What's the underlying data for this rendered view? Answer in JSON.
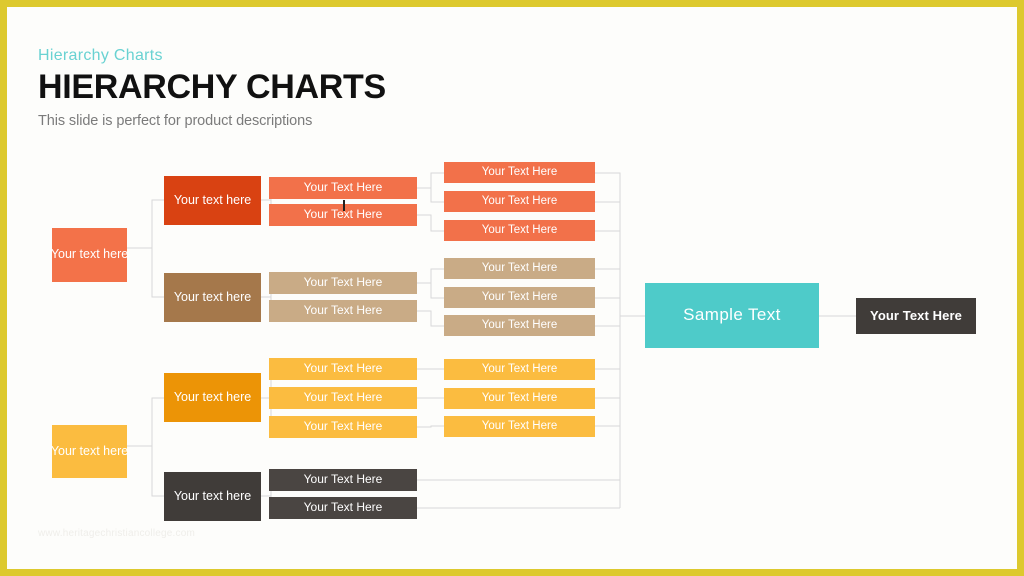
{
  "slide": {
    "eyebrow": "Hierarchy Charts",
    "title": "HIERARCHY CHARTS",
    "subtitle": "This slide is perfect for product descriptions",
    "watermark": "www.heritagechristiancollege.com",
    "frame_color": "#ddc92e",
    "background": "#fdfdfb"
  },
  "palette": {
    "red_dark": "#d94212",
    "coral": "#f2714a",
    "salmon": "#f37249",
    "brown": "#a5784b",
    "tan": "#c9ab86",
    "amber_dark": "#ec9406",
    "amber": "#fbbc40",
    "charcoal": "#403c39",
    "charcoal_light": "#4a4542",
    "teal": "#4ecbc9",
    "connector": "#d8d8d8",
    "text_on_fill": "#ffffff"
  },
  "chart_data": {
    "type": "diagram",
    "title": "Hierarchy Charts",
    "orientation": "left-to-right",
    "levels": 5
  },
  "nodes": {
    "root_red": {
      "label": "Your text here",
      "color": "#f37249"
    },
    "root_amber": {
      "label": "Your text here",
      "color": "#fbbc40"
    },
    "branch_red": {
      "label": "Your text here",
      "color": "#d94212"
    },
    "branch_brown": {
      "label": "Your text here",
      "color": "#a5784b"
    },
    "branch_amber": {
      "label": "Your text here",
      "color": "#ec9406"
    },
    "branch_dark": {
      "label": "Your text here",
      "color": "#403c39"
    },
    "hub": {
      "label": "Sample  Text",
      "color": "#4ecbc9"
    },
    "tail": {
      "label": "Your  Text Here",
      "color": "#403c39"
    }
  },
  "groups": {
    "red_mid": {
      "color": "#f2714a",
      "items": [
        "Your Text Here",
        "Your Text Here"
      ]
    },
    "red_leaf": {
      "color": "#f2714a",
      "items": [
        "Your Text Here",
        "Your Text Here",
        "Your Text Here"
      ]
    },
    "brown_mid": {
      "color": "#c9ab86",
      "items": [
        "Your Text Here",
        "Your Text Here"
      ]
    },
    "brown_leaf": {
      "color": "#c9ab86",
      "items": [
        "Your Text Here",
        "Your Text Here",
        "Your Text Here"
      ]
    },
    "amber_mid": {
      "color": "#fbbc40",
      "items": [
        "Your Text Here",
        "Your Text Here",
        "Your Text Here"
      ]
    },
    "amber_leaf": {
      "color": "#fbbc40",
      "items": [
        "Your Text Here",
        "Your Text Here",
        "Your Text Here"
      ]
    },
    "dark_mid": {
      "color": "#4a4542",
      "items": [
        "Your Text Here",
        "Your Text Here"
      ]
    }
  }
}
